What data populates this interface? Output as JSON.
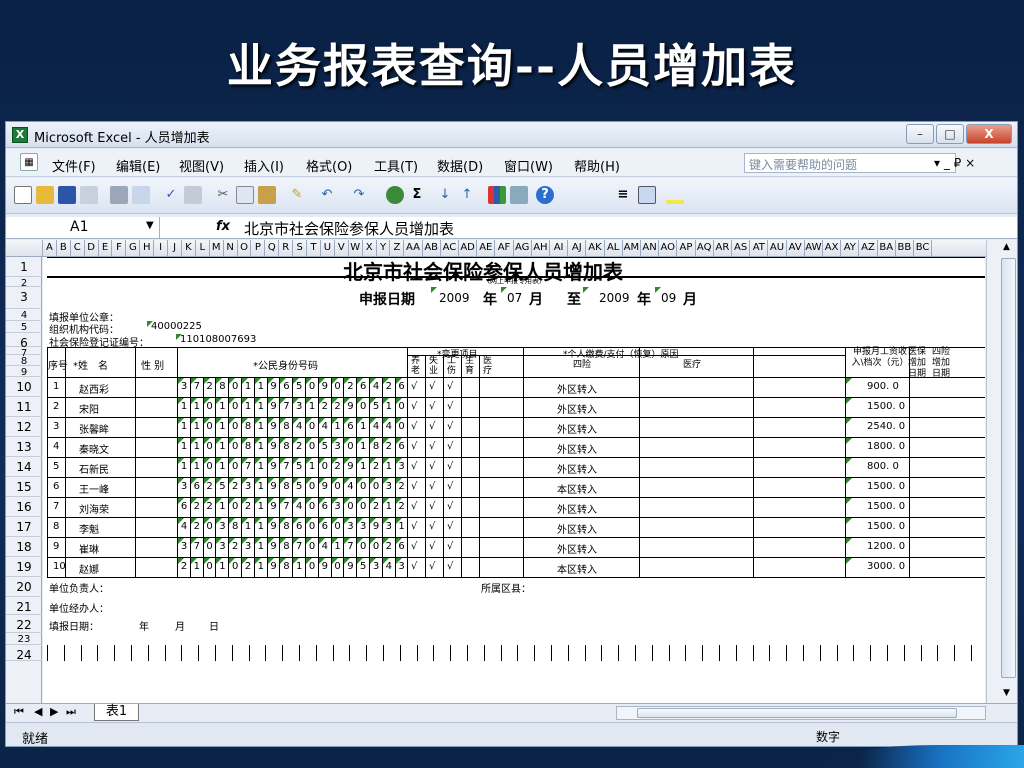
{
  "slide": {
    "title": "业务报表查询--人员增加表"
  },
  "window": {
    "title": "Microsoft Excel - 人员增加表",
    "controls": [
      "–",
      "□",
      "X"
    ]
  },
  "menu": {
    "items": [
      "文件(F)",
      "编辑(E)",
      "视图(V)",
      "插入(I)",
      "格式(O)",
      "工具(T)",
      "数据(D)",
      "窗口(W)",
      "帮助(H)"
    ],
    "help_placeholder": "键入需要帮助的问题",
    "doc_controls": "▾ _ ₽ ×"
  },
  "formula_bar": {
    "cell_ref": "A1",
    "fx": "fx",
    "content": "北京市社会保险参保人员增加表"
  },
  "columns": [
    "A",
    "B",
    "C",
    "D",
    "E",
    "F",
    "G",
    "H",
    "I",
    "J",
    "K",
    "L",
    "M",
    "N",
    "O",
    "P",
    "Q",
    "R",
    "S",
    "T",
    "U",
    "V",
    "W",
    "X",
    "Y",
    "Z",
    "AA",
    "AB",
    "AC",
    "AD",
    "AE",
    "AF",
    "AG",
    "AH",
    "AI",
    "AJ",
    "AK",
    "AL",
    "AM",
    "AN",
    "AO",
    "AP",
    "AQ",
    "AR",
    "AS",
    "AT",
    "AU",
    "AV",
    "AW",
    "AX",
    "AY",
    "AZ",
    "BA",
    "BB",
    "BC"
  ],
  "row_numbers": [
    "1",
    "2",
    "3",
    "4",
    "5",
    "6",
    "7",
    "8",
    "9",
    "10",
    "11",
    "12",
    "13",
    "14",
    "15",
    "16",
    "17",
    "18",
    "19",
    "20",
    "21",
    "22",
    "23",
    "24"
  ],
  "report": {
    "title": "北京市社会保险参保人员增加表",
    "subtitle_note": "（网上申报专用表）",
    "period": {
      "label": "申报日期",
      "start_year": "2009",
      "year_unit": "年",
      "start_month": "07",
      "month_unit": "月",
      "to": "至",
      "end_year": "2009",
      "end_month": "09"
    },
    "seal_label": "填报单位公章：",
    "org_code_label": "组织机构代码：",
    "org_code": "40000225",
    "reg_no_label": "社会保险登记证编号：",
    "reg_no": "110108007693",
    "headers": {
      "seq": "序号",
      "name": "*姓　名",
      "gender": "性 别",
      "id": "*公民身份号码",
      "change_items": "*变更项目",
      "change_cols": [
        "养老",
        "失业",
        "工伤",
        "生育",
        "医疗"
      ],
      "reason": "*个人缴费/支付（恢复）原因",
      "reason_cols": [
        "四险",
        "医疗"
      ],
      "wage": "申报月工资收入\\档次（元）",
      "four_ins_date": "四险增加日期",
      "med_date": "医保增加日期"
    },
    "rows": [
      {
        "seq": "1",
        "name": "赵西彩",
        "id": "372801196509026426",
        "checks": [
          "√",
          "√",
          "√"
        ],
        "reason": "外区转入",
        "wage": "900. 0"
      },
      {
        "seq": "2",
        "name": "宋阳",
        "id": "110101197312290510",
        "checks": [
          "√",
          "√",
          "√"
        ],
        "reason": "外区转入",
        "wage": "1500. 0"
      },
      {
        "seq": "3",
        "name": "张馨眸",
        "id": "110108198404161440",
        "checks": [
          "√",
          "√",
          "√"
        ],
        "reason": "外区转入",
        "wage": "2540. 0"
      },
      {
        "seq": "4",
        "name": "秦晓文",
        "id": "110108198205301826",
        "checks": [
          "√",
          "√",
          "√"
        ],
        "reason": "外区转入",
        "wage": "1800. 0"
      },
      {
        "seq": "5",
        "name": "石新民",
        "id": "110107197510291213",
        "checks": [
          "√",
          "√",
          "√"
        ],
        "reason": "外区转入",
        "wage": "800. 0"
      },
      {
        "seq": "6",
        "name": "王一峰",
        "id": "362523198509040032",
        "checks": [
          "√",
          "√",
          "√"
        ],
        "reason": "本区转入",
        "wage": "1500. 0"
      },
      {
        "seq": "7",
        "name": "刘海荣",
        "id": "622102197406300212",
        "checks": [
          "√",
          "√",
          "√"
        ],
        "reason": "外区转入",
        "wage": "1500. 0"
      },
      {
        "seq": "8",
        "name": "李魁",
        "id": "420381198606033931",
        "checks": [
          "√",
          "√",
          "√"
        ],
        "reason": "外区转入",
        "wage": "1500. 0"
      },
      {
        "seq": "9",
        "name": "崔琳",
        "id": "370323198704170026",
        "checks": [
          "√",
          "√",
          "√"
        ],
        "reason": "外区转入",
        "wage": "1200. 0"
      },
      {
        "seq": "10",
        "name": "赵娜",
        "id": "210102198109095343",
        "checks": [
          "√",
          "√",
          "√"
        ],
        "reason": "本区转入",
        "wage": "3000. 0"
      }
    ],
    "responsible_label": "单位负责人：",
    "district_label": "所属区县：",
    "handler_label": "单位经办人：",
    "fill_date_label": "填报日期：",
    "fill_date_year": "年",
    "fill_date_month": "月",
    "fill_date_day": "日"
  },
  "sheet_tab": "表1",
  "status": {
    "left": "就绪",
    "right": "数字"
  }
}
